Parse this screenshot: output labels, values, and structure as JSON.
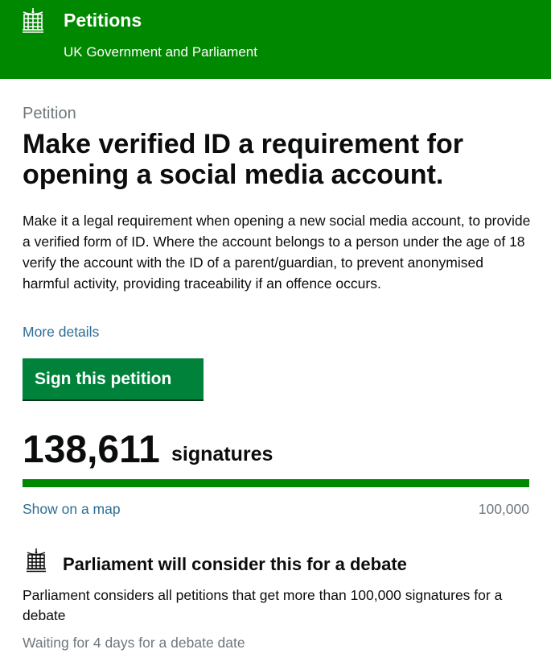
{
  "header": {
    "logo_icon": "portcullis-icon",
    "title": "Petitions",
    "subtitle": "UK Government and Parliament",
    "background": "#008800"
  },
  "petition": {
    "eyebrow": "Petition",
    "title": "Make verified ID a requirement for opening a social media account.",
    "body": "Make it a legal requirement when opening a new social media account, to provide a verified form of ID. Where the account belongs to a person under the age of 18 verify the account with the ID of a parent/guardian, to prevent anonymised harmful activity, providing traceability if an offence occurs.",
    "more_details_label": "More details",
    "sign_button_label": "Sign this petition"
  },
  "signatures": {
    "count": "138,611",
    "label": "signatures",
    "progress_fraction": 1.0,
    "map_link_label": "Show on a map",
    "threshold_label": "100,000"
  },
  "debate": {
    "icon": "portcullis-icon",
    "heading": "Parliament will consider this for a debate",
    "body": "Parliament considers all petitions that get more than 100,000 signatures for a debate",
    "status": "Waiting for 4 days for a debate date"
  },
  "colors": {
    "brand_green": "#008800",
    "button_green": "#00823b",
    "link_blue": "#2e6d95",
    "secondary_grey": "#6f777b"
  }
}
